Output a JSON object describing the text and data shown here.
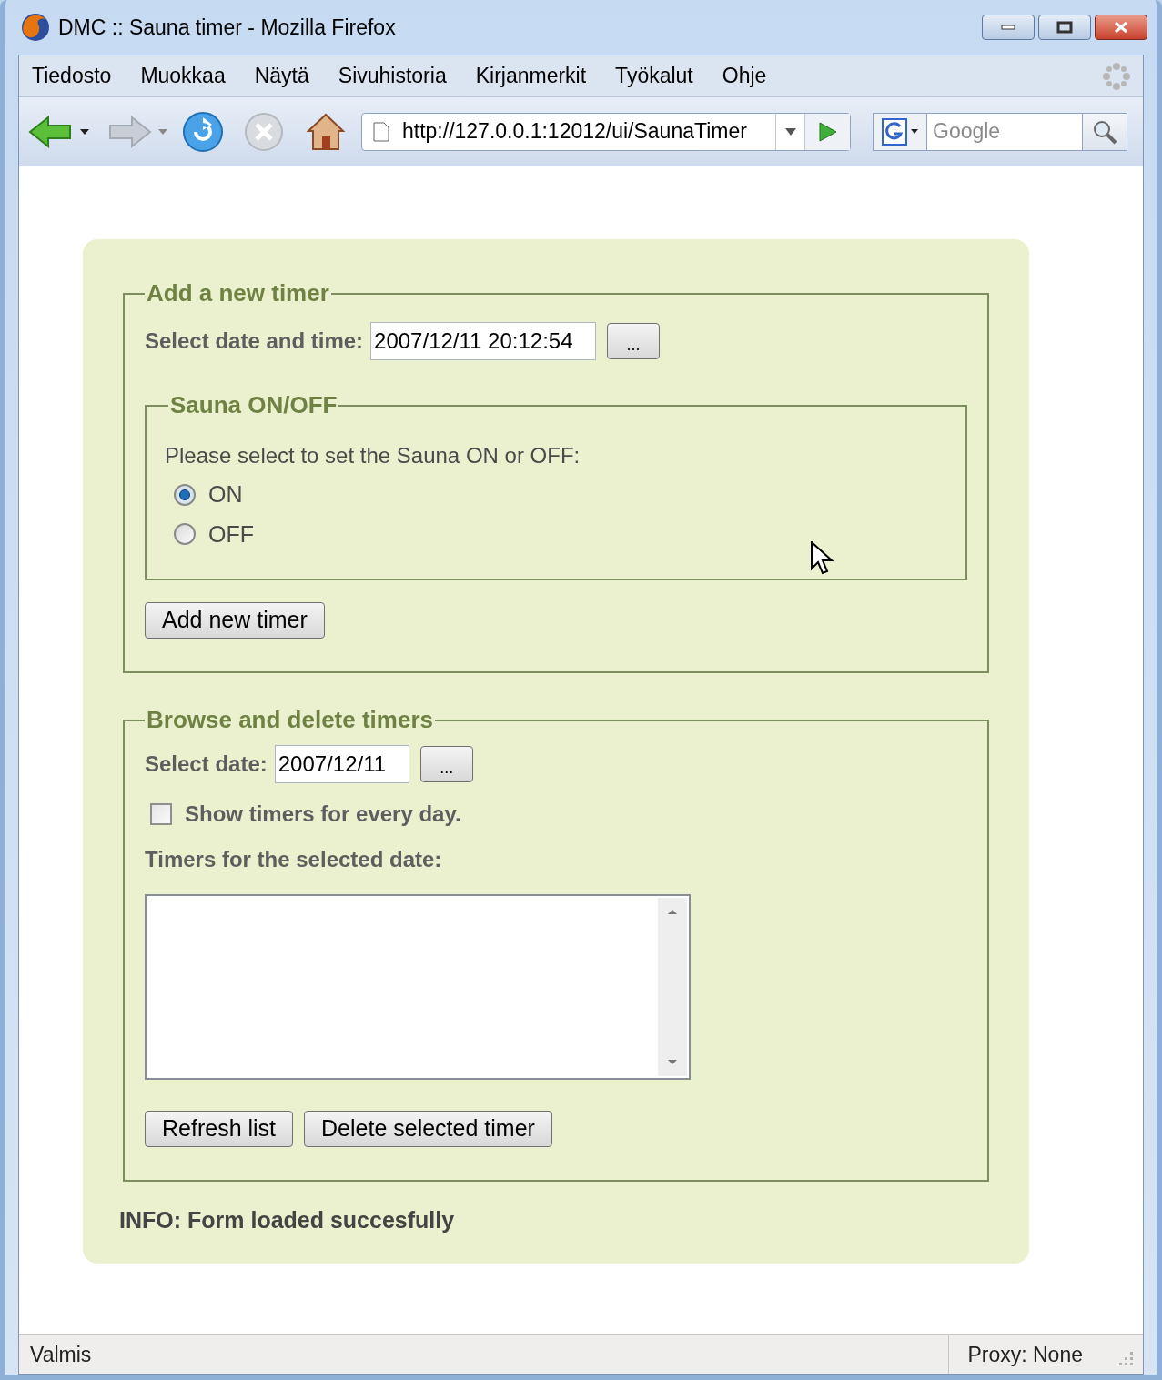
{
  "window": {
    "title": "DMC :: Sauna timer - Mozilla Firefox"
  },
  "menu": [
    "Tiedosto",
    "Muokkaa",
    "Näytä",
    "Sivuhistoria",
    "Kirjanmerkit",
    "Työkalut",
    "Ohje"
  ],
  "toolbar": {
    "url": "http://127.0.0.1:12012/ui/SaunaTimer",
    "search": {
      "placeholder": "Google"
    }
  },
  "add_timer": {
    "legend": "Add a new timer",
    "datetime_label": "Select date and time:",
    "datetime_value": "2007/12/11 20:12:54",
    "picker_button": "...",
    "sauna": {
      "legend": "Sauna ON/OFF",
      "prompt": "Please select to set the Sauna ON or OFF:",
      "options": [
        {
          "label": "ON",
          "selected": true
        },
        {
          "label": "OFF",
          "selected": false
        }
      ]
    },
    "submit": "Add new timer"
  },
  "browse": {
    "legend": "Browse and delete timers",
    "date_label": "Select date:",
    "date_value": "2007/12/11",
    "picker_button": "...",
    "show_every_day": {
      "label": "Show timers for every day.",
      "checked": false
    },
    "list_label": "Timers for the selected date:",
    "buttons": [
      "Refresh list",
      "Delete selected timer"
    ]
  },
  "info": "INFO: Form loaded succesfully",
  "status_bar": {
    "text": "Valmis",
    "proxy": "Proxy: None"
  }
}
